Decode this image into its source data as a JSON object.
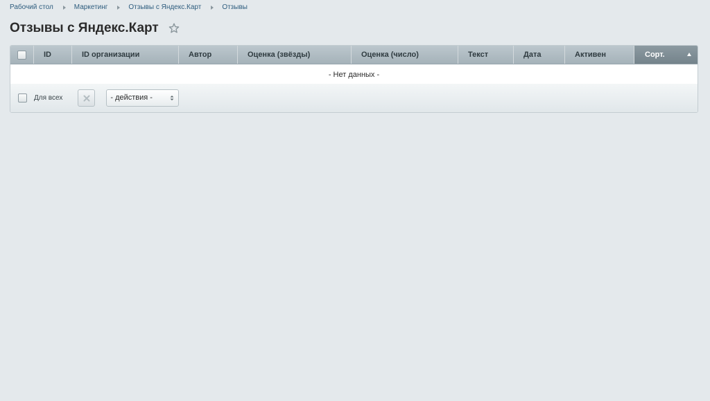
{
  "breadcrumb": [
    {
      "label": "Рабочий стол"
    },
    {
      "label": "Маркетинг"
    },
    {
      "label": "Отзывы с Яндекс.Карт"
    },
    {
      "label": "Отзывы"
    }
  ],
  "page_title": "Отзывы с Яндекс.Карт",
  "table": {
    "columns": [
      "ID",
      "ID организации",
      "Автор",
      "Оценка (звёзды)",
      "Оценка (число)",
      "Текст",
      "Дата",
      "Активен",
      "Сорт."
    ],
    "sorted_column": "Сорт.",
    "sort_direction": "ascending",
    "empty_text": "- Нет данных -"
  },
  "footer": {
    "for_all_label": "Для всех",
    "actions_select_value": "- действия -"
  },
  "colors": {
    "background": "#e4e9ec",
    "header": "#a5b2b9",
    "sorted_header": "#74838b",
    "link": "#2e5d7e"
  }
}
